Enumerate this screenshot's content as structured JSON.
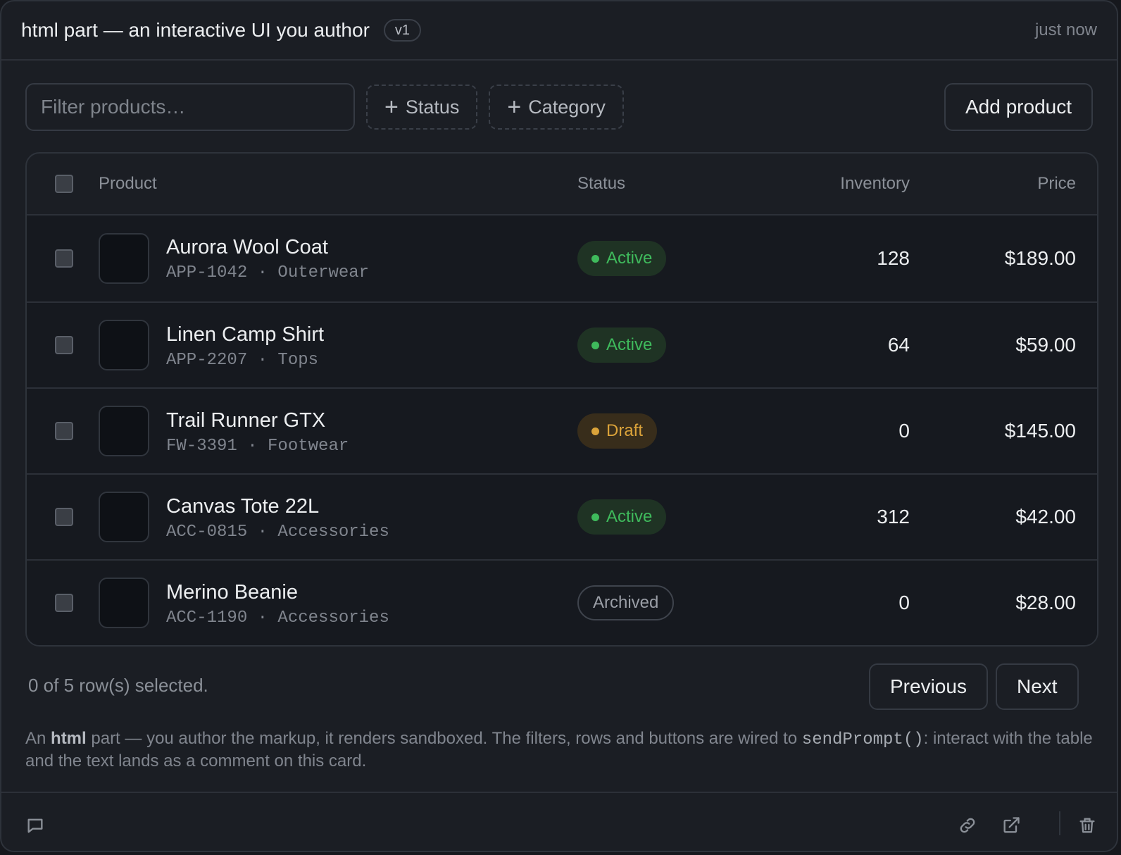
{
  "header": {
    "title": "html part — an interactive UI you author",
    "version": "v1",
    "timestamp": "just now"
  },
  "toolbar": {
    "filter_placeholder": "Filter products…",
    "filter_value": "",
    "status_label": "Status",
    "category_label": "Category",
    "add_label": "Add product"
  },
  "table": {
    "columns": {
      "product": "Product",
      "status": "Status",
      "inventory": "Inventory",
      "price": "Price"
    },
    "rows": [
      {
        "name": "Aurora Wool Coat",
        "meta": "APP-1042 · Outerwear",
        "status": "Active",
        "inventory": "128",
        "price": "$189.00"
      },
      {
        "name": "Linen Camp Shirt",
        "meta": "APP-2207 · Tops",
        "status": "Active",
        "inventory": "64",
        "price": "$59.00"
      },
      {
        "name": "Trail Runner GTX",
        "meta": "FW-3391 · Footwear",
        "status": "Draft",
        "inventory": "0",
        "price": "$145.00"
      },
      {
        "name": "Canvas Tote 22L",
        "meta": "ACC-0815 · Accessories",
        "status": "Active",
        "inventory": "312",
        "price": "$42.00"
      },
      {
        "name": "Merino Beanie",
        "meta": "ACC-1190 · Accessories",
        "status": "Archived",
        "inventory": "0",
        "price": "$28.00"
      }
    ]
  },
  "footer": {
    "selection": "0 of 5 row(s) selected.",
    "previous_label": "Previous",
    "next_label": "Next",
    "description": {
      "prefix": "An ",
      "bold": "html",
      "middle": " part — you author the markup, it renders sandboxed. The filters, rows and buttons are wired to ",
      "code": "sendPrompt()",
      "suffix": ": interact with the table and the text lands as a comment on this card."
    }
  },
  "colors": {
    "active": "#3fba5c",
    "draft": "#dba33a",
    "archived": "#9a9ea6",
    "background": "#1b1e24"
  },
  "icons": [
    "plus-icon",
    "status-dot-icon",
    "comment-icon",
    "link-icon",
    "external-link-icon",
    "trash-icon"
  ]
}
